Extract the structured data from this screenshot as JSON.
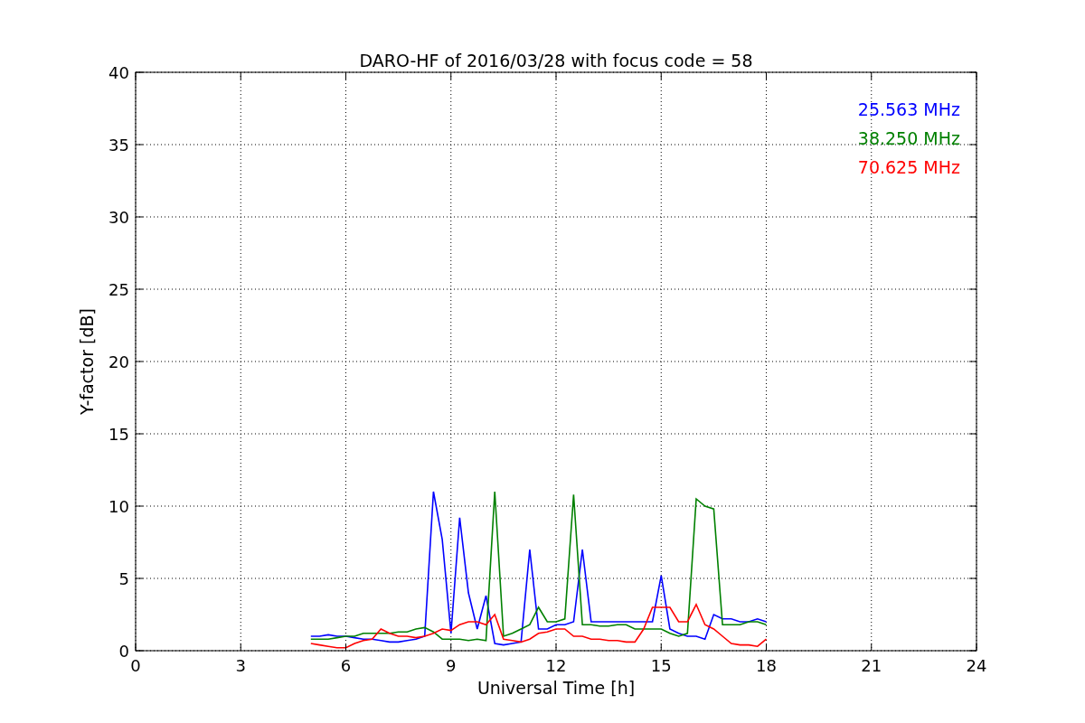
{
  "figure": {
    "chart_data": {
      "type": "line",
      "title": "DARO-HF of 2016/03/28 with focus code = 58",
      "xlabel": "Universal Time [h]",
      "ylabel": "Y-factor [dB]",
      "x": [
        5,
        5.25,
        5.5,
        5.75,
        6,
        6.25,
        6.5,
        6.75,
        7,
        7.25,
        7.5,
        7.75,
        8,
        8.25,
        8.5,
        8.75,
        9,
        9.25,
        9.5,
        9.75,
        10,
        10.25,
        10.5,
        10.75,
        11,
        11.25,
        11.5,
        11.75,
        12,
        12.25,
        12.5,
        12.75,
        13,
        13.25,
        13.5,
        13.75,
        14,
        14.25,
        14.5,
        14.75,
        15,
        15.25,
        15.5,
        15.75,
        16,
        16.25,
        16.5,
        16.75,
        17,
        17.25,
        17.5,
        17.75,
        18
      ],
      "series": [
        {
          "name": "25.563 MHz",
          "color": "#0000ff",
          "values": [
            1,
            1,
            1.1,
            1,
            1,
            0.9,
            0.8,
            0.8,
            0.7,
            0.6,
            0.6,
            0.7,
            0.8,
            1,
            11,
            7.7,
            1.2,
            9.2,
            4,
            1.5,
            3.8,
            0.5,
            0.4,
            0.5,
            0.6,
            7,
            1.5,
            1.5,
            1.8,
            1.8,
            2,
            7,
            2,
            2,
            2,
            2,
            2,
            2,
            2,
            2,
            5.2,
            1.5,
            1.2,
            1,
            1,
            0.8,
            2.5,
            2.2,
            2.2,
            2,
            2,
            2.2,
            2
          ]
        },
        {
          "name": "38.250 MHz",
          "color": "#008000",
          "values": [
            0.8,
            0.8,
            0.8,
            0.9,
            1,
            1,
            1.2,
            1.2,
            1.2,
            1.2,
            1.3,
            1.3,
            1.5,
            1.6,
            1.3,
            0.8,
            0.8,
            0.8,
            0.7,
            0.8,
            0.7,
            11,
            1,
            1.2,
            1.5,
            1.8,
            3,
            2,
            2,
            2.2,
            10.8,
            1.8,
            1.8,
            1.7,
            1.7,
            1.8,
            1.8,
            1.5,
            1.5,
            1.5,
            1.5,
            1.2,
            1,
            1.2,
            10.5,
            10,
            9.8,
            1.8,
            1.8,
            1.8,
            2,
            2,
            1.8
          ]
        },
        {
          "name": "70.625 MHz",
          "color": "#ff0000",
          "values": [
            0.5,
            0.4,
            0.3,
            0.2,
            0.2,
            0.5,
            0.7,
            0.8,
            1.5,
            1.2,
            1,
            1,
            0.9,
            1,
            1.2,
            1.5,
            1.4,
            1.8,
            2,
            2,
            1.8,
            2.5,
            0.8,
            0.7,
            0.6,
            0.8,
            1.2,
            1.3,
            1.5,
            1.5,
            1,
            1,
            0.8,
            0.8,
            0.7,
            0.7,
            0.6,
            0.6,
            1.5,
            3,
            3,
            3,
            2,
            2,
            3.2,
            1.8,
            1.5,
            1,
            0.5,
            0.4,
            0.4,
            0.3,
            0.8
          ]
        }
      ],
      "grid": true,
      "xlim": [
        0,
        24
      ],
      "ylim": [
        0,
        40
      ],
      "xticks": [
        0,
        3,
        6,
        9,
        12,
        15,
        18,
        21,
        24
      ],
      "yticks": [
        0,
        5,
        10,
        15,
        20,
        25,
        30,
        35,
        40
      ]
    }
  }
}
